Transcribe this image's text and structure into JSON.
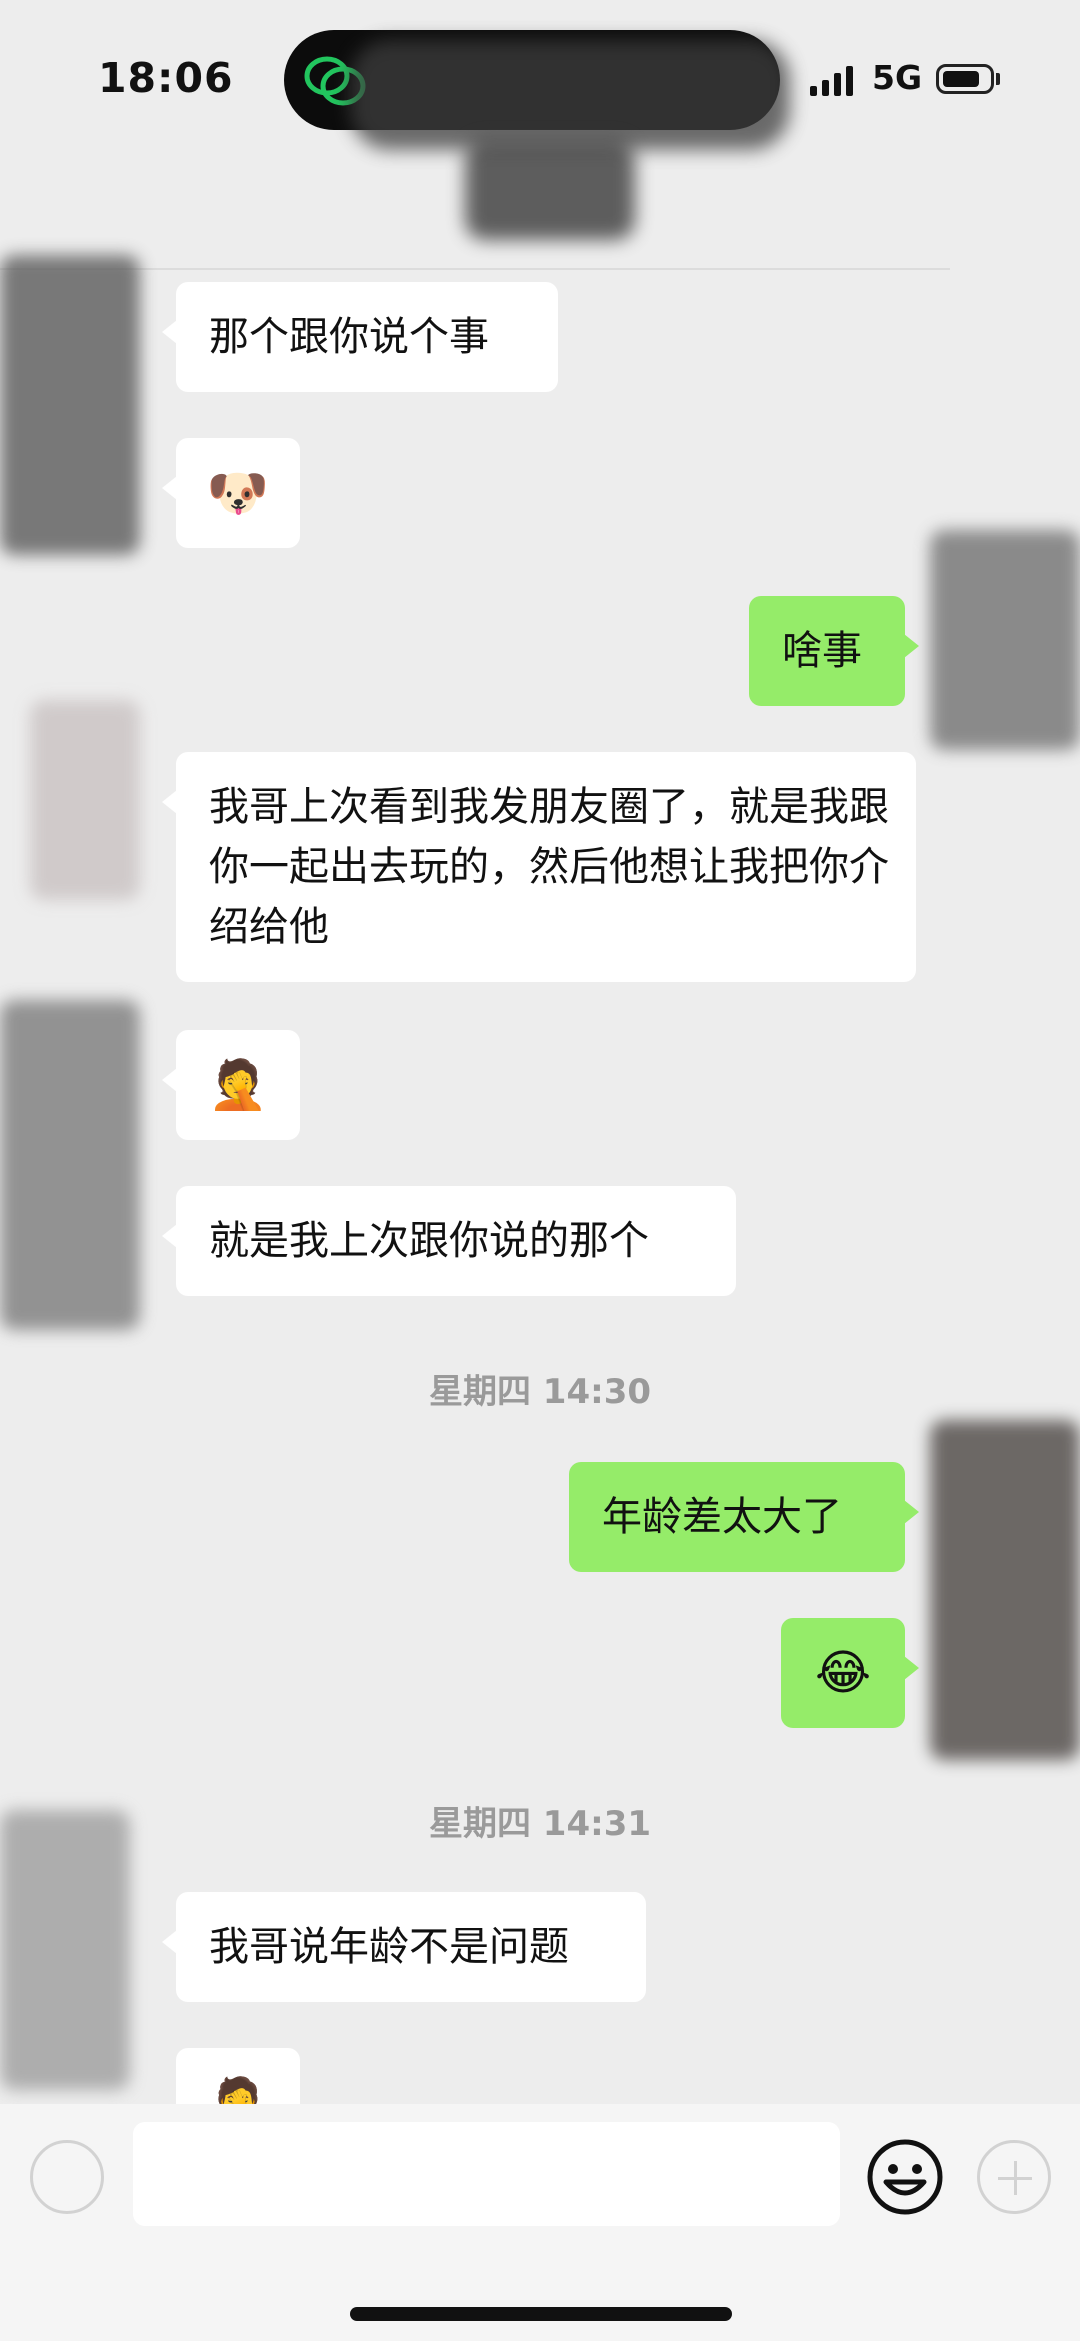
{
  "status_bar": {
    "time": "18:06",
    "network": "5G",
    "icons": [
      "wechat-icon",
      "signal-icon",
      "battery-icon"
    ]
  },
  "messages": [
    {
      "id": "m1",
      "side": "incoming",
      "type": "text",
      "text": "那个跟你说个事"
    },
    {
      "id": "m2",
      "side": "incoming",
      "type": "emoji",
      "emoji": "🐶",
      "icon": "doge-emoji-icon"
    },
    {
      "id": "m3",
      "side": "outgoing",
      "type": "text",
      "text": "啥事"
    },
    {
      "id": "m4",
      "side": "incoming",
      "type": "text",
      "text": "我哥上次看到我发朋友圈了，就是我跟你一起出去玩的，然后他想让我把你介绍给他"
    },
    {
      "id": "m5",
      "side": "incoming",
      "type": "emoji",
      "emoji": "🤦",
      "icon": "facepalm-crying-emoji-icon"
    },
    {
      "id": "m6",
      "side": "incoming",
      "type": "text",
      "text": "就是我上次跟你说的那个"
    },
    {
      "id": "t1",
      "type": "timestamp",
      "text": "星期四 14:30"
    },
    {
      "id": "m7",
      "side": "outgoing",
      "type": "text",
      "text": "年龄差太大了"
    },
    {
      "id": "m8",
      "side": "outgoing",
      "type": "emoji",
      "emoji": "😂",
      "icon": "tears-of-joy-emoji-icon"
    },
    {
      "id": "t2",
      "type": "timestamp",
      "text": "星期四 14:31"
    },
    {
      "id": "m9",
      "side": "incoming",
      "type": "text",
      "text": "我哥说年龄不是问题"
    },
    {
      "id": "m10",
      "side": "incoming",
      "type": "emoji",
      "emoji": "🤦",
      "icon": "facepalm-crying-emoji-icon"
    }
  ],
  "input_bar": {
    "value": "",
    "icons": [
      "voice-icon",
      "emoji-icon",
      "plus-icon"
    ]
  },
  "colors": {
    "background": "#ededed",
    "incoming_bubble": "#ffffff",
    "outgoing_bubble": "#95ec69",
    "timestamp": "#9a9a9a"
  }
}
